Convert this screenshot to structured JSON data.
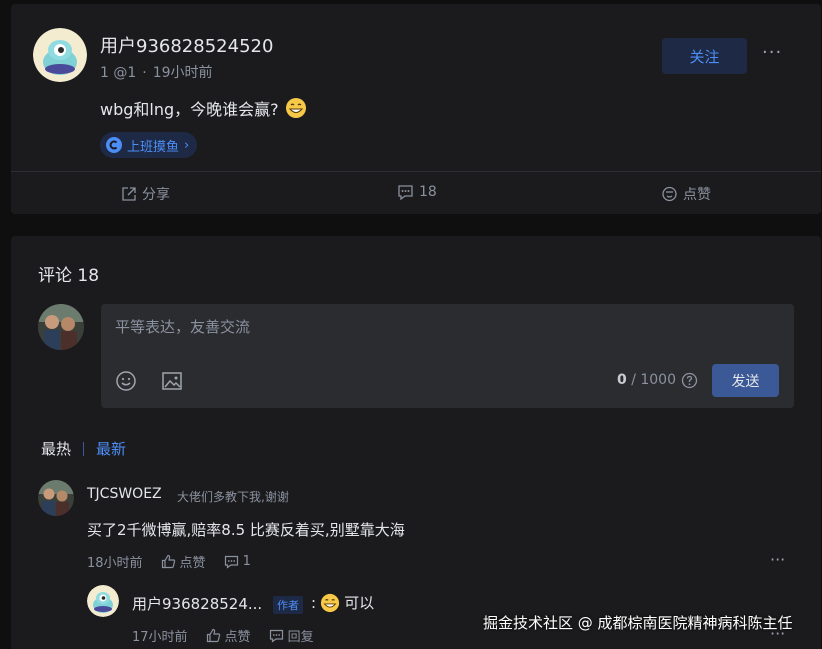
{
  "post": {
    "username": "用户936828524520",
    "level": "1 @1",
    "time": "19小时前",
    "follow_label": "关注",
    "text": "wbg和lng，今晚谁会赢?",
    "topic": "上班摸鱼",
    "topic_arrow": "›",
    "share_label": "分享",
    "comment_count": "18",
    "like_label": "点赞"
  },
  "comments_section": {
    "title": "评论 18",
    "placeholder": "平等表达，友善交流",
    "char_current": "0",
    "char_max": "/ 1000",
    "send_label": "发送",
    "sort_hot": "最热",
    "sort_new": "最新"
  },
  "comments": [
    {
      "name": "TJCSWOEZ",
      "bio": "大佬们多教下我,谢谢",
      "text": "买了2千微博赢,赔率8.5 比赛反着买,别墅靠大海",
      "time": "18小时前",
      "like_label": "点赞",
      "reply_count": "1"
    }
  ],
  "reply": {
    "name": "用户936828524...",
    "badge": "作者",
    "colon": ":",
    "text": "可以",
    "time": "17小时前",
    "like_label": "点赞",
    "reply_label": "回复"
  },
  "watermark": "掘金技术社区 @ 成都棕南医院精神病科陈主任",
  "colors": {
    "accent": "#4c8df6",
    "card_bg": "#1b1b1d",
    "page_bg": "#0f0f10",
    "send_button": "#3b5996"
  }
}
